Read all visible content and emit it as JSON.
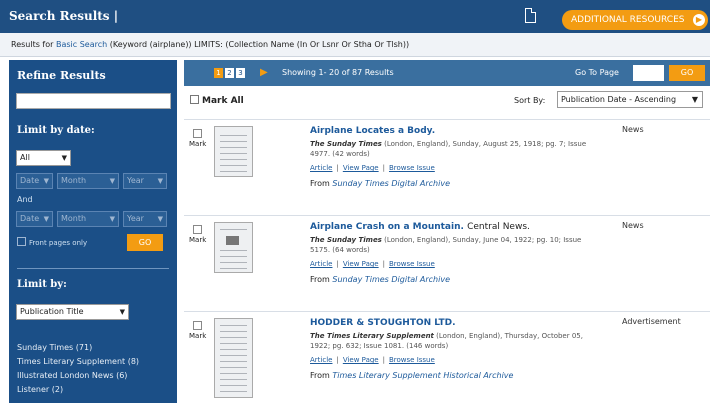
{
  "header": {
    "title": "Search Results |",
    "additional_resources": "ADDITIONAL RESOURCES"
  },
  "results_for": {
    "prefix": "Results for",
    "search_type": "Basic Search",
    "query": "(Keyword (airplane)) LIMITS: (Collection Name (In Or Lsnr Or Stha Or Tlsh))"
  },
  "sidebar": {
    "title": "Refine Results",
    "limit_by_date": "Limit by date:",
    "date_mode": "All",
    "date_from": {
      "date": "Date",
      "month": "Month",
      "year": "Year"
    },
    "and_label": "And",
    "date_to": {
      "date": "Date",
      "month": "Month",
      "year": "Year"
    },
    "front_pages_only": "Front pages only",
    "go_label": "GO",
    "limit_by": "Limit by:",
    "limit_by_field": "Publication Title",
    "facets": [
      "Sunday Times (71)",
      "Times Literary Supplement (8)",
      "Illustrated London News (6)",
      "Listener (2)"
    ]
  },
  "pagination": {
    "pages": [
      "1",
      "2",
      "3"
    ],
    "current_page": "1",
    "showing": "Showing 1- 20 of 87 Results",
    "go_to_page": "Go To Page",
    "go_label": "GO"
  },
  "list_controls": {
    "mark_all": "Mark All",
    "sort_by_label": "Sort By:",
    "sort_value": "Publication Date - Ascending"
  },
  "results": [
    {
      "mark_label": "Mark",
      "title": "Airplane Locates a Body.",
      "subtitle": "",
      "source_pub": "The Sunday Times",
      "source_rest": "(London, England), Sunday, August 25, 1918; pg. 7; Issue 4977. (42 words)",
      "links": [
        "Article",
        "View Page",
        "Browse Issue"
      ],
      "from_label": "From",
      "archive": "Sunday Times Digital Archive",
      "type": "News"
    },
    {
      "mark_label": "Mark",
      "title": "Airplane Crash on a Mountain.",
      "subtitle": "Central News.",
      "source_pub": "The Sunday Times",
      "source_rest": "(London, England), Sunday, June 04, 1922; pg. 10; Issue 5175. (64 words)",
      "links": [
        "Article",
        "View Page",
        "Browse Issue"
      ],
      "from_label": "From",
      "archive": "Sunday Times Digital Archive",
      "type": "News"
    },
    {
      "mark_label": "Mark",
      "title": "HODDER & STOUGHTON LTD.",
      "subtitle": "",
      "source_pub": "The Times Literary Supplement",
      "source_rest": "(London, England), Thursday, October 05, 1922; pg. 632; Issue 1081. (146 words)",
      "links": [
        "Article",
        "View Page",
        "Browse Issue"
      ],
      "from_label": "From",
      "archive": "Times Literary Supplement Historical Archive",
      "type": "Advertisement"
    }
  ]
}
